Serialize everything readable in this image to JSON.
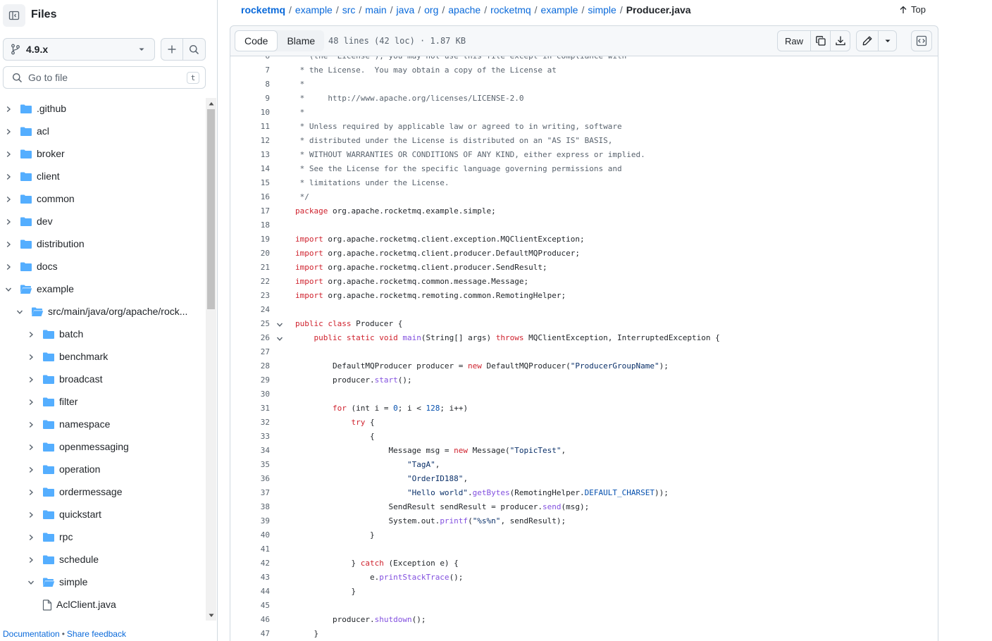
{
  "sidebar": {
    "title": "Files",
    "branch": "4.9.x",
    "goto_placeholder": "Go to file",
    "goto_shortcut": "t",
    "tree": [
      {
        "name": ".github",
        "depth": 0,
        "type": "folder",
        "expanded": false
      },
      {
        "name": "acl",
        "depth": 0,
        "type": "folder",
        "expanded": false
      },
      {
        "name": "broker",
        "depth": 0,
        "type": "folder",
        "expanded": false
      },
      {
        "name": "client",
        "depth": 0,
        "type": "folder",
        "expanded": false
      },
      {
        "name": "common",
        "depth": 0,
        "type": "folder",
        "expanded": false
      },
      {
        "name": "dev",
        "depth": 0,
        "type": "folder",
        "expanded": false
      },
      {
        "name": "distribution",
        "depth": 0,
        "type": "folder",
        "expanded": false
      },
      {
        "name": "docs",
        "depth": 0,
        "type": "folder",
        "expanded": false
      },
      {
        "name": "example",
        "depth": 0,
        "type": "folder",
        "expanded": true
      },
      {
        "name": "src/main/java/org/apache/rock...",
        "depth": 1,
        "type": "folder",
        "expanded": true
      },
      {
        "name": "batch",
        "depth": 2,
        "type": "folder",
        "expanded": false
      },
      {
        "name": "benchmark",
        "depth": 2,
        "type": "folder",
        "expanded": false
      },
      {
        "name": "broadcast",
        "depth": 2,
        "type": "folder",
        "expanded": false
      },
      {
        "name": "filter",
        "depth": 2,
        "type": "folder",
        "expanded": false
      },
      {
        "name": "namespace",
        "depth": 2,
        "type": "folder",
        "expanded": false
      },
      {
        "name": "openmessaging",
        "depth": 2,
        "type": "folder",
        "expanded": false
      },
      {
        "name": "operation",
        "depth": 2,
        "type": "folder",
        "expanded": false
      },
      {
        "name": "ordermessage",
        "depth": 2,
        "type": "folder",
        "expanded": false
      },
      {
        "name": "quickstart",
        "depth": 2,
        "type": "folder",
        "expanded": false
      },
      {
        "name": "rpc",
        "depth": 2,
        "type": "folder",
        "expanded": false
      },
      {
        "name": "schedule",
        "depth": 2,
        "type": "folder",
        "expanded": false
      },
      {
        "name": "simple",
        "depth": 2,
        "type": "folder",
        "expanded": true
      },
      {
        "name": "AclClient.java",
        "depth": 3,
        "type": "file",
        "expanded": false
      }
    ],
    "footer": {
      "documentation": "Documentation",
      "separator": "•",
      "feedback": "Share feedback"
    }
  },
  "breadcrumb": {
    "parts": [
      "rocketmq",
      "example",
      "src",
      "main",
      "java",
      "org",
      "apache",
      "rocketmq",
      "example",
      "simple"
    ],
    "current": "Producer.java",
    "top_label": "Top"
  },
  "file_header": {
    "tab_code": "Code",
    "tab_blame": "Blame",
    "meta": "48 lines (42 loc) · 1.87 KB",
    "raw": "Raw"
  },
  "code": {
    "first_line": 6,
    "lines": [
      [
        [
          "c",
          " * (the \"License\"); you may not use this file except in compliance with"
        ]
      ],
      [
        [
          "c",
          " * the License.  You may obtain a copy of the License at"
        ]
      ],
      [
        [
          "c",
          " *"
        ]
      ],
      [
        [
          "c",
          " *     http://www.apache.org/licenses/LICENSE-2.0"
        ]
      ],
      [
        [
          "c",
          " *"
        ]
      ],
      [
        [
          "c",
          " * Unless required by applicable law or agreed to in writing, software"
        ]
      ],
      [
        [
          "c",
          " * distributed under the License is distributed on an \"AS IS\" BASIS,"
        ]
      ],
      [
        [
          "c",
          " * WITHOUT WARRANTIES OR CONDITIONS OF ANY KIND, either express or implied."
        ]
      ],
      [
        [
          "c",
          " * See the License for the specific language governing permissions and"
        ]
      ],
      [
        [
          "c",
          " * limitations under the License."
        ]
      ],
      [
        [
          "c",
          " */"
        ]
      ],
      [
        [
          "k",
          "package"
        ],
        [
          "",
          " org.apache.rocketmq.example.simple;"
        ]
      ],
      [
        [
          "",
          ""
        ]
      ],
      [
        [
          "k",
          "import"
        ],
        [
          "",
          " org.apache.rocketmq.client.exception.MQClientException;"
        ]
      ],
      [
        [
          "k",
          "import"
        ],
        [
          "",
          " org.apache.rocketmq.client.producer.DefaultMQProducer;"
        ]
      ],
      [
        [
          "k",
          "import"
        ],
        [
          "",
          " org.apache.rocketmq.client.producer.SendResult;"
        ]
      ],
      [
        [
          "k",
          "import"
        ],
        [
          "",
          " org.apache.rocketmq.common.message.Message;"
        ]
      ],
      [
        [
          "k",
          "import"
        ],
        [
          "",
          " org.apache.rocketmq.remoting.common.RemotingHelper;"
        ]
      ],
      [
        [
          "",
          ""
        ]
      ],
      [
        [
          "k",
          "public class"
        ],
        [
          "",
          " Producer {"
        ]
      ],
      [
        [
          "",
          "    "
        ],
        [
          "k",
          "public static void"
        ],
        [
          "",
          " "
        ],
        [
          "f",
          "main"
        ],
        [
          "",
          "(String[] args) "
        ],
        [
          "k",
          "throws"
        ],
        [
          "",
          " MQClientException, InterruptedException {"
        ]
      ],
      [
        [
          "",
          ""
        ]
      ],
      [
        [
          "",
          "        DefaultMQProducer producer = "
        ],
        [
          "k",
          "new"
        ],
        [
          "",
          " DefaultMQProducer("
        ],
        [
          "s",
          "\"ProducerGroupName\""
        ],
        [
          "",
          ");"
        ]
      ],
      [
        [
          "",
          "        producer."
        ],
        [
          "f",
          "start"
        ],
        [
          "",
          "();"
        ]
      ],
      [
        [
          "",
          ""
        ]
      ],
      [
        [
          "",
          "        "
        ],
        [
          "k",
          "for"
        ],
        [
          "",
          " (int i = "
        ],
        [
          "n",
          "0"
        ],
        [
          "",
          "; i < "
        ],
        [
          "n",
          "128"
        ],
        [
          "",
          "; i++)"
        ]
      ],
      [
        [
          "",
          "            "
        ],
        [
          "k",
          "try"
        ],
        [
          "",
          " {"
        ]
      ],
      [
        [
          "",
          "                {"
        ]
      ],
      [
        [
          "",
          "                    Message msg = "
        ],
        [
          "k",
          "new"
        ],
        [
          "",
          " Message("
        ],
        [
          "s",
          "\"TopicTest\""
        ],
        [
          "",
          ","
        ]
      ],
      [
        [
          "",
          "                        "
        ],
        [
          "s",
          "\"TagA\""
        ],
        [
          "",
          ","
        ]
      ],
      [
        [
          "",
          "                        "
        ],
        [
          "s",
          "\"OrderID188\""
        ],
        [
          "",
          ","
        ]
      ],
      [
        [
          "",
          "                        "
        ],
        [
          "s",
          "\"Hello world\""
        ],
        [
          "",
          "."
        ],
        [
          "f",
          "getBytes"
        ],
        [
          "",
          "(RemotingHelper."
        ],
        [
          "n",
          "DEFAULT_CHARSET"
        ],
        [
          "",
          "));"
        ]
      ],
      [
        [
          "",
          "                    SendResult sendResult = producer."
        ],
        [
          "f",
          "send"
        ],
        [
          "",
          "(msg);"
        ]
      ],
      [
        [
          "",
          "                    System.out."
        ],
        [
          "f",
          "printf"
        ],
        [
          "",
          "("
        ],
        [
          "s",
          "\"%s%n\""
        ],
        [
          "",
          ", sendResult);"
        ]
      ],
      [
        [
          "",
          "                }"
        ]
      ],
      [
        [
          "",
          ""
        ]
      ],
      [
        [
          "",
          "            } "
        ],
        [
          "k",
          "catch"
        ],
        [
          "",
          " (Exception e) {"
        ]
      ],
      [
        [
          "",
          "                e."
        ],
        [
          "f",
          "printStackTrace"
        ],
        [
          "",
          "();"
        ]
      ],
      [
        [
          "",
          "            }"
        ]
      ],
      [
        [
          "",
          ""
        ]
      ],
      [
        [
          "",
          "        producer."
        ],
        [
          "f",
          "shutdown"
        ],
        [
          "",
          "();"
        ]
      ],
      [
        [
          "",
          "    }"
        ]
      ]
    ],
    "fold_lines": [
      25,
      26
    ]
  },
  "colors": {
    "folder": "#54aeff",
    "link": "#0969da",
    "keyword": "#cf222e",
    "string": "#0a3069",
    "function": "#8250df",
    "constant": "#0550ae",
    "comment": "#59636e"
  }
}
